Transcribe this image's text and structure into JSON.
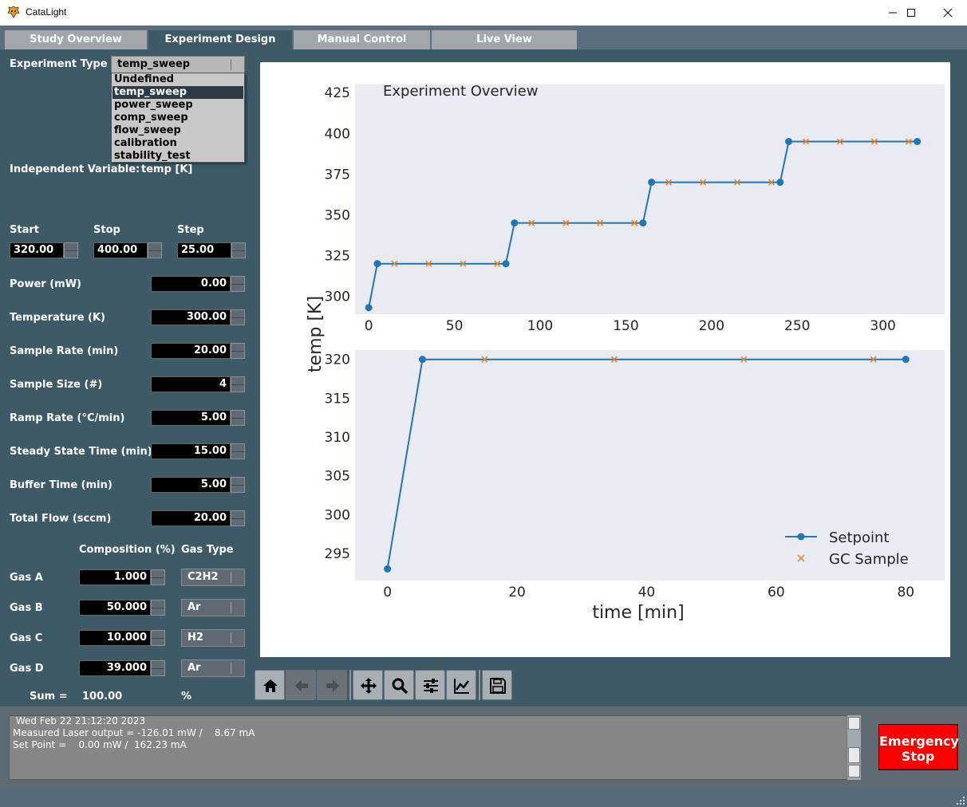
{
  "window": {
    "title": "CataLight"
  },
  "tabs": [
    {
      "label": "Study Overview"
    },
    {
      "label": "Experiment Design"
    },
    {
      "label": "Manual Control"
    },
    {
      "label": "Live View"
    }
  ],
  "form": {
    "experiment_type_label": "Experiment Type",
    "experiment_type_value": "temp_sweep",
    "experiment_type_options": [
      "Undefined",
      "temp_sweep",
      "power_sweep",
      "comp_sweep",
      "flow_sweep",
      "calibration",
      "stability_test"
    ],
    "independent_variable_label": "Independent Variable:",
    "independent_variable_value": "temp [K]",
    "start_label": "Start",
    "stop_label": "Stop",
    "step_label": "Step",
    "start_value": "320.00",
    "stop_value": "400.00",
    "step_value": "25.00",
    "fields": [
      {
        "label": "Power (mW)",
        "value": "0.00"
      },
      {
        "label": "Temperature (K)",
        "value": "300.00"
      },
      {
        "label": "Sample Rate (min)",
        "value": "20.00"
      },
      {
        "label": "Sample Size (#)",
        "value": "4"
      },
      {
        "label": "Ramp Rate (°C/min)",
        "value": "5.00"
      },
      {
        "label": "Steady State Time (min)",
        "value": "15.00"
      },
      {
        "label": "Buffer Time (min)",
        "value": "5.00"
      },
      {
        "label": "Total Flow (sccm)",
        "value": "20.00"
      }
    ],
    "composition_header": "Composition (%)",
    "gas_type_header": "Gas Type",
    "gases": [
      {
        "label": "Gas A",
        "composition": "1.000",
        "type": "C2H2"
      },
      {
        "label": "Gas B",
        "composition": "50.000",
        "type": "Ar"
      },
      {
        "label": "Gas C",
        "composition": "10.000",
        "type": "H2"
      },
      {
        "label": "Gas D",
        "composition": "39.000",
        "type": "Ar"
      }
    ],
    "sum_label": "Sum =",
    "sum_value": "100.00",
    "sum_unit": "%"
  },
  "toolbar": {
    "icons": [
      "home-icon",
      "back-arrow-icon",
      "forward-arrow-icon",
      "pan-icon",
      "zoom-icon",
      "configure-subplots-icon",
      "edit-axis-icon",
      "save-icon"
    ]
  },
  "log": {
    "lines": [
      " Wed Feb 22 21:12:20 2023",
      "Measured Laser output = -126.01 mW /    8.67 mA",
      "Set Point =    0.00 mW /  162.23 mA"
    ]
  },
  "emergency": {
    "line1": "Emergency",
    "line2": "Stop"
  },
  "colors": {
    "setpoint": "#1f77b4",
    "gc_sample": "#ff7f0e",
    "plot_bg": "#eaeaf2",
    "estop": "#ff0000"
  },
  "chart_data": [
    {
      "type": "line",
      "title": "Experiment Overview",
      "xlabel": "",
      "ylabel": "temp [K]",
      "xlim": [
        -8,
        336
      ],
      "ylim": [
        289,
        430
      ],
      "xticks": [
        0,
        50,
        100,
        150,
        200,
        250,
        300
      ],
      "yticks": [
        300,
        325,
        350,
        375,
        400,
        425
      ],
      "series": [
        {
          "name": "Setpoint",
          "x": [
            0,
            5,
            80,
            85,
            160,
            165,
            240,
            245,
            320
          ],
          "y": [
            293,
            320,
            320,
            345,
            345,
            370,
            370,
            395,
            395
          ]
        },
        {
          "name": "GC Sample",
          "x": [
            15,
            35,
            55,
            75,
            95,
            115,
            135,
            155,
            175,
            195,
            215,
            235,
            255,
            275,
            295,
            315
          ],
          "y": [
            320,
            320,
            320,
            320,
            345,
            345,
            345,
            345,
            370,
            370,
            370,
            370,
            395,
            395,
            395,
            395
          ]
        }
      ]
    },
    {
      "type": "line",
      "title": "",
      "xlabel": "time [min]",
      "ylabel": "temp [K]",
      "xlim": [
        -5,
        86
      ],
      "ylim": [
        291.5,
        321.2
      ],
      "xticks": [
        0,
        20,
        40,
        60,
        80
      ],
      "yticks": [
        295,
        300,
        305,
        310,
        315,
        320
      ],
      "legend": "lower-right",
      "series": [
        {
          "name": "Setpoint",
          "x": [
            0,
            5.4,
            80
          ],
          "y": [
            293,
            320,
            320
          ]
        },
        {
          "name": "GC Sample",
          "x": [
            15,
            35,
            55,
            75
          ],
          "y": [
            320,
            320,
            320,
            320
          ]
        }
      ]
    }
  ]
}
